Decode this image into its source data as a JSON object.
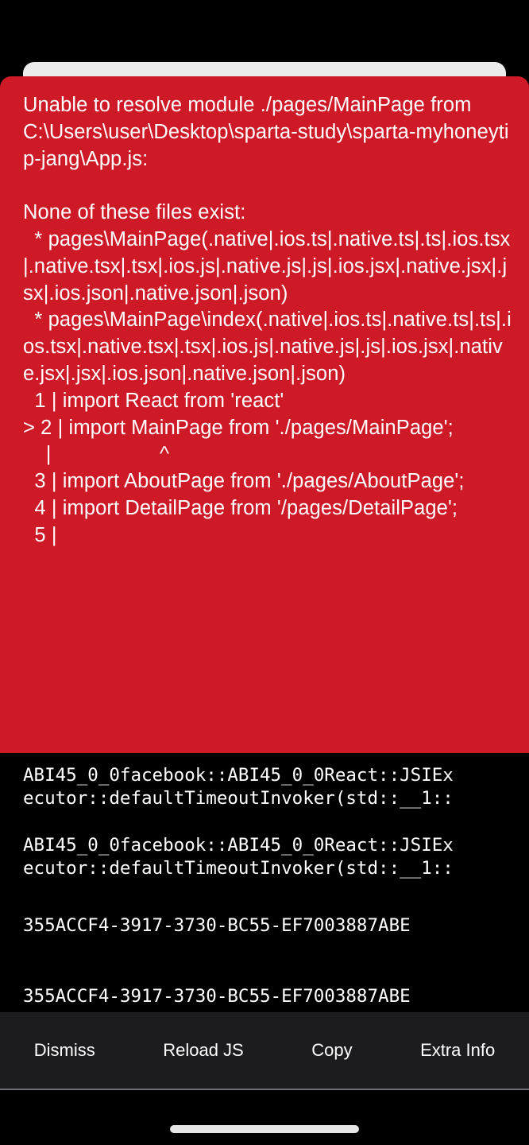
{
  "error": {
    "message": "Unable to resolve module ./pages/MainPage from C:\\Users\\user\\Desktop\\sparta-study\\sparta-myhoneytip-jang\\App.js:\n\nNone of these files exist:\n  * pages\\MainPage(.native|.ios.ts|.native.ts|.ts|.ios.tsx|.native.tsx|.tsx|.ios.js|.native.js|.js|.ios.jsx|.native.jsx|.jsx|.ios.json|.native.json|.json)\n  * pages\\MainPage\\index(.native|.ios.ts|.native.ts|.ts|.ios.tsx|.native.tsx|.tsx|.ios.js|.native.js|.js|.ios.jsx|.native.jsx|.jsx|.ios.json|.native.json|.json)\n  1 | import React from 'react'\n> 2 | import MainPage from './pages/MainPage';\n    |                   ^\n  3 | import AboutPage from './pages/AboutPage';\n  4 | import DetailPage from '/pages/DetailPage';\n  5 |"
  },
  "stack": {
    "frames": [
      "ABI45_0_0facebook::ABI45_0_0React::JSIEx\necutor::defaultTimeoutInvoker(std::__1::",
      "ABI45_0_0facebook::ABI45_0_0React::JSIEx\necutor::defaultTimeoutInvoker(std::__1::",
      "355ACCF4-3917-3730-BC55-EF7003887ABE",
      "355ACCF4-3917-3730-BC55-EF7003887ABE"
    ]
  },
  "toolbar": {
    "dismiss_label": "Dismiss",
    "reload_label": "Reload JS",
    "copy_label": "Copy",
    "extra_label": "Extra Info"
  },
  "colors": {
    "redbox": "#ce1a26",
    "background": "#000000",
    "toolbar": "#1c1c1e",
    "text": "#ffffff"
  }
}
